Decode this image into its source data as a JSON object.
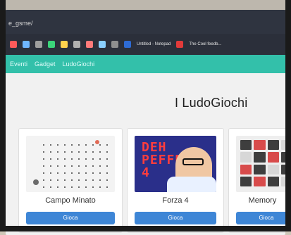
{
  "browser": {
    "address_fragment": "e_gsme/",
    "bookmarks": [
      {
        "label": "Untitled - Notepad",
        "color": "#2e6bd4"
      },
      {
        "label": "The Cool feedb...",
        "color": "#e23a3a"
      }
    ]
  },
  "nav": {
    "items": [
      {
        "label": "Eventi"
      },
      {
        "label": "Gadget"
      },
      {
        "label": "LudoGiochi"
      }
    ]
  },
  "page": {
    "title": "I LudoGiochi"
  },
  "cards": [
    {
      "title": "Campo Minato",
      "button": "Gioca",
      "icon": "minesweeper-grid"
    },
    {
      "title": "Forza 4",
      "button": "Gioca",
      "icon": "forza4-thumbnail"
    },
    {
      "title": "Memory",
      "button": "Gioca",
      "icon": "memory-grid"
    }
  ],
  "colors": {
    "teal_nav": "#33c0aa",
    "button_blue": "#3e86d6",
    "page_bg": "#f1f1f1",
    "title": "#1f1f1f"
  }
}
